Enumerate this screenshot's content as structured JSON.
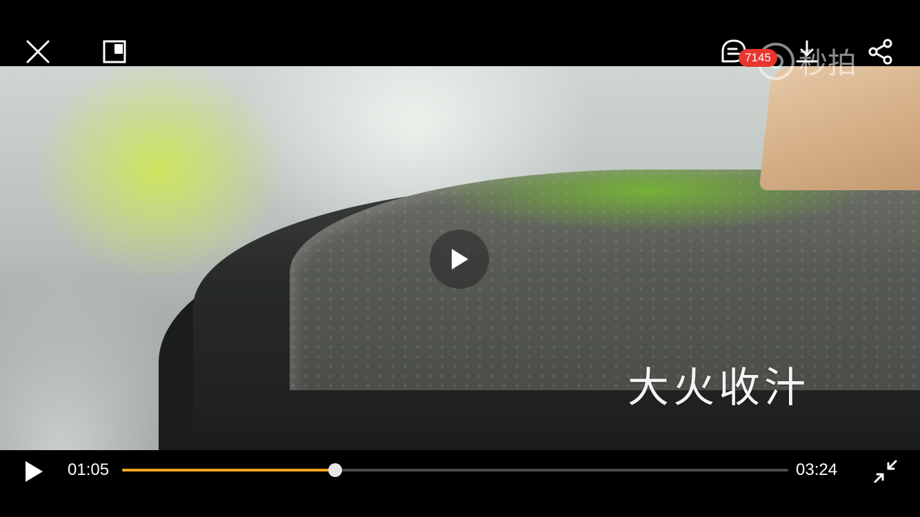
{
  "top_bar": {
    "close_icon": "close-icon",
    "pip_icon": "picture-in-picture-icon",
    "comment_icon": "comment-icon",
    "comment_count": "7145",
    "download_icon": "download-icon",
    "share_icon": "share-icon"
  },
  "video": {
    "watermark": "秒拍",
    "subtitle": "大火收汁",
    "center_play_icon": "play-icon"
  },
  "controls": {
    "play_icon": "play-icon",
    "current_time": "01:05",
    "total_time": "03:24",
    "progress_fraction": 0.32,
    "exit_fullscreen_icon": "exit-fullscreen-icon"
  },
  "colors": {
    "accent": "#f5a623",
    "badge": "#e8362f",
    "track": "#4a4a4a",
    "background": "#000000"
  }
}
